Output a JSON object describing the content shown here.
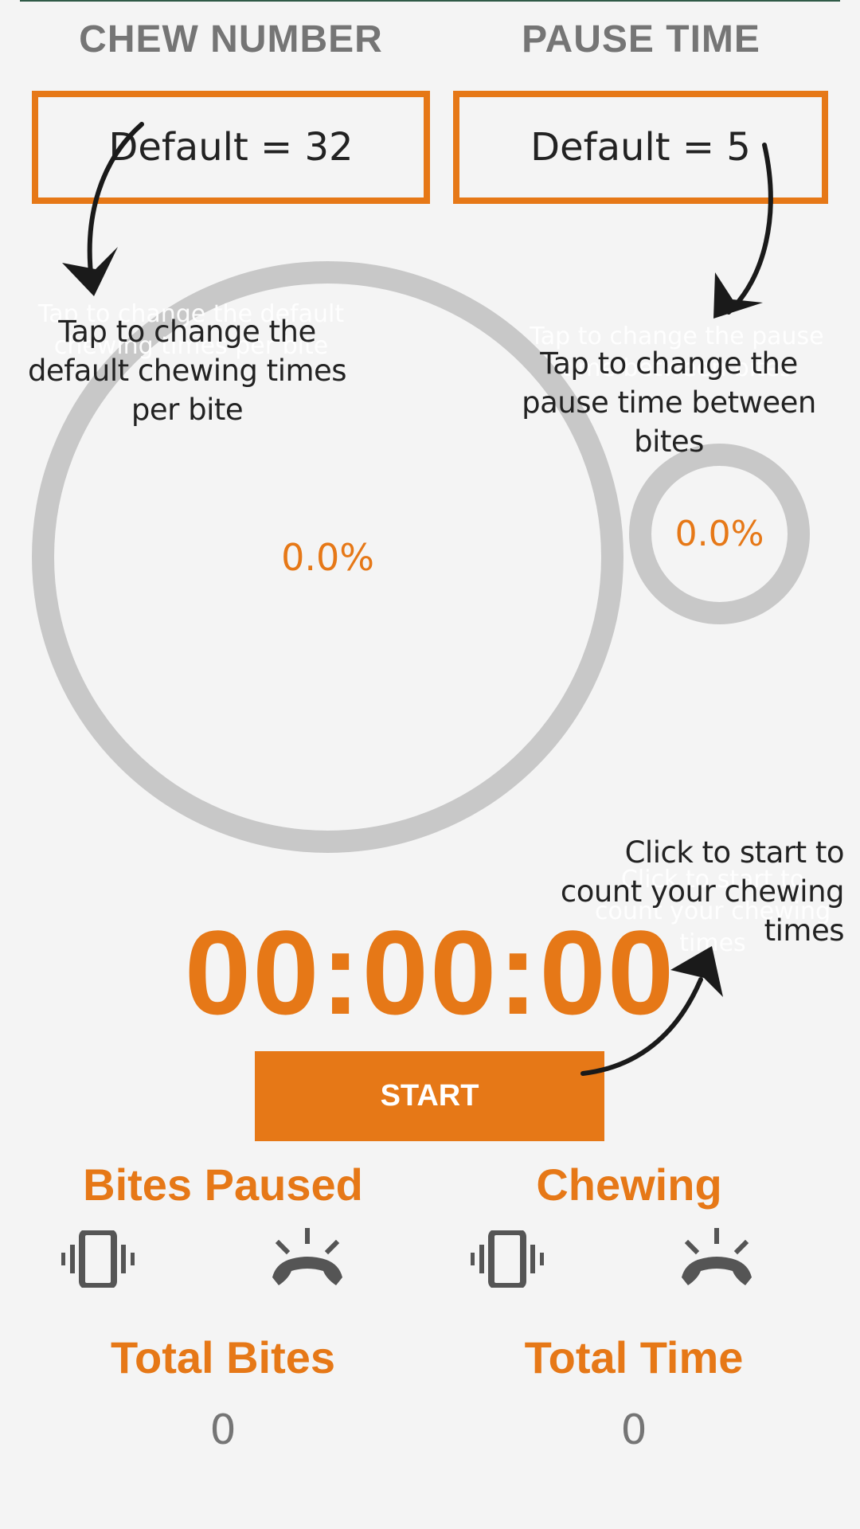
{
  "header": {
    "chew_label": "CHEW NUMBER",
    "pause_label": "PAUSE TIME"
  },
  "chew_box": {
    "value": "Default = 32"
  },
  "pause_box": {
    "value": "Default = 5"
  },
  "hints": {
    "chew": "Tap to change the default chewing times per bite",
    "pause": "Tap to change the pause time between bites",
    "start": "Click to start to count your chewing times"
  },
  "ghost_hints": {
    "chew": "Tap to change the default chewing times per bite",
    "pause": "Tap to change the pause time between bites",
    "start": "Click to start to count your chewing times"
  },
  "progress": {
    "chew_percent": "0.0%",
    "pause_percent": "0.0%"
  },
  "timer": {
    "display": "00:00:00"
  },
  "start_button": {
    "label": "START"
  },
  "modes": {
    "bites_paused": "Bites Paused",
    "chewing": "Chewing"
  },
  "stats": {
    "total_bites_label": "Total Bites",
    "total_bites_value": "0",
    "total_time_label": "Total Time",
    "total_time_value": "0"
  },
  "icons": {
    "vibrate": "vibrate-icon",
    "ring_volume": "ring-volume-icon"
  },
  "colors": {
    "accent": "#e67817",
    "ring": "#c8c8c8",
    "label_gray": "#757575",
    "background": "#f4f4f4"
  }
}
